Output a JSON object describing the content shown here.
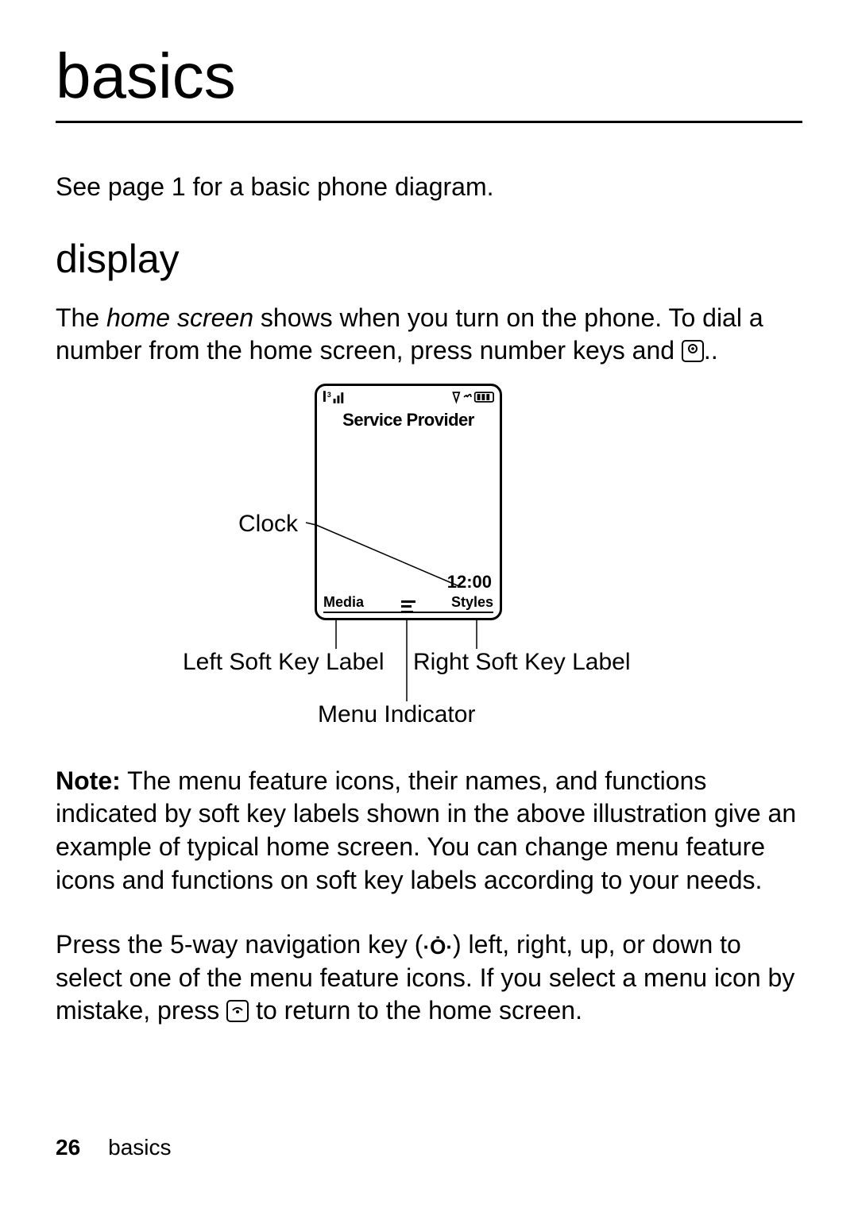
{
  "title": "basics",
  "intro_line": "See page 1 for a basic phone diagram.",
  "section_heading": "display",
  "para1_a": "The ",
  "para1_em": "home screen",
  "para1_b": " shows when you turn on the phone. To dial a number from the home screen, press number keys and ",
  "para1_c": "..",
  "diagram": {
    "provider": "Service Provider",
    "clock": "12:00",
    "left_soft": "Media",
    "right_soft": "Styles",
    "labels": {
      "clock": "Clock",
      "left": "Left Soft Key Label",
      "right": "Right Soft Key Label",
      "menu": "Menu Indicator"
    }
  },
  "note_label": "Note:",
  "note_body": " The menu feature icons, their names, and functions indicated by soft key labels shown in the above illustration give an example of typical home screen. You can change menu feature icons and functions on soft key labels according to your needs.",
  "para3_a": "Press the 5-way navigation key (",
  "para3_b": ") left, right, up, or down to select one of the menu feature icons. If you select a menu icon by mistake, press ",
  "para3_c": " to return to the home screen.",
  "footer": {
    "page": "26",
    "section": "basics"
  }
}
